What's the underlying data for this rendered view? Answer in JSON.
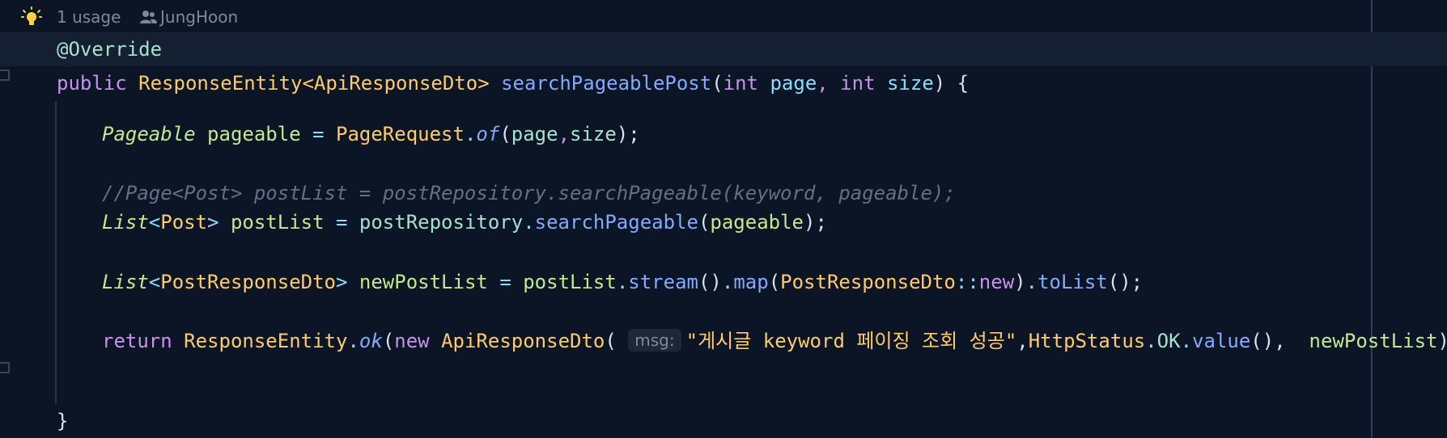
{
  "hint": {
    "usages": "1 usage",
    "author": "JungHoon"
  },
  "code": {
    "line1": {
      "annotation": "@Override"
    },
    "line2": {
      "public": "public",
      "return_type": "ResponseEntity",
      "lt": "<",
      "generic": "ApiResponseDto",
      "gt": ">",
      "space": " ",
      "method": "searchPageablePost",
      "open": "(",
      "int1": "int",
      "page": "page",
      "comma": ",",
      "int2": "int",
      "size": "size",
      "close": ")",
      "brace": " {"
    },
    "line3": {
      "type": "Pageable",
      "var": "pageable",
      "eq": "=",
      "cls": "PageRequest",
      "dot": ".",
      "fn": "of",
      "open": "(",
      "arg1": "page",
      "comma": ",",
      "arg2": "size",
      "close": ");"
    },
    "line4": {
      "comment": "//Page<Post> postList = postRepository.searchPageable(keyword, pageable);"
    },
    "line5": {
      "type": "List",
      "lt": "<",
      "generic": "Post",
      "gt": ">",
      "var": "postList",
      "eq": "=",
      "obj": "postRepository",
      "dot": ".",
      "fn": "searchPageable",
      "open": "(",
      "arg": "pageable",
      "close": ");"
    },
    "line6": {
      "type": "List",
      "lt": "<",
      "generic": "PostResponseDto",
      "gt": ">",
      "var": "newPostList",
      "eq": "=",
      "obj": "postList",
      "dot1": ".",
      "fn1": "stream",
      "paren1": "()",
      "dot2": ".",
      "fn2": "map",
      "open2": "(",
      "ref_cls": "PostResponseDto",
      "dcolon": "::",
      "ref_new": "new",
      "close2": ")",
      "dot3": ".",
      "fn3": "toList",
      "end": "();"
    },
    "line7": {
      "return": "return",
      "cls": "ResponseEntity",
      "dot": ".",
      "fn": "ok",
      "open": "(",
      "new": "new",
      "ctor": "ApiResponseDto",
      "open2": "(",
      "param_hint": "msg:",
      "string": "\"게시글 keyword 페이징 조회 성공\"",
      "comma1": ",",
      "status_cls": "HttpStatus",
      "dot2": ".",
      "status_const": "OK",
      "dot3": ".",
      "value_fn": "value",
      "paren": "()",
      "comma2": ",",
      "arg_list": "newPostList",
      "end": "));"
    },
    "line8": {
      "brace": "}"
    }
  },
  "colors": {
    "background": "#0b1525",
    "current_line": "#141f31",
    "keyword": "#c792ea",
    "type": "#ffcb6b",
    "function": "#82aaff",
    "variable": "#c3e88d",
    "comment": "#636f82",
    "bulb": "#ffd23f"
  },
  "icons": {
    "bulb": "lightbulb-icon",
    "author": "person-icon"
  }
}
